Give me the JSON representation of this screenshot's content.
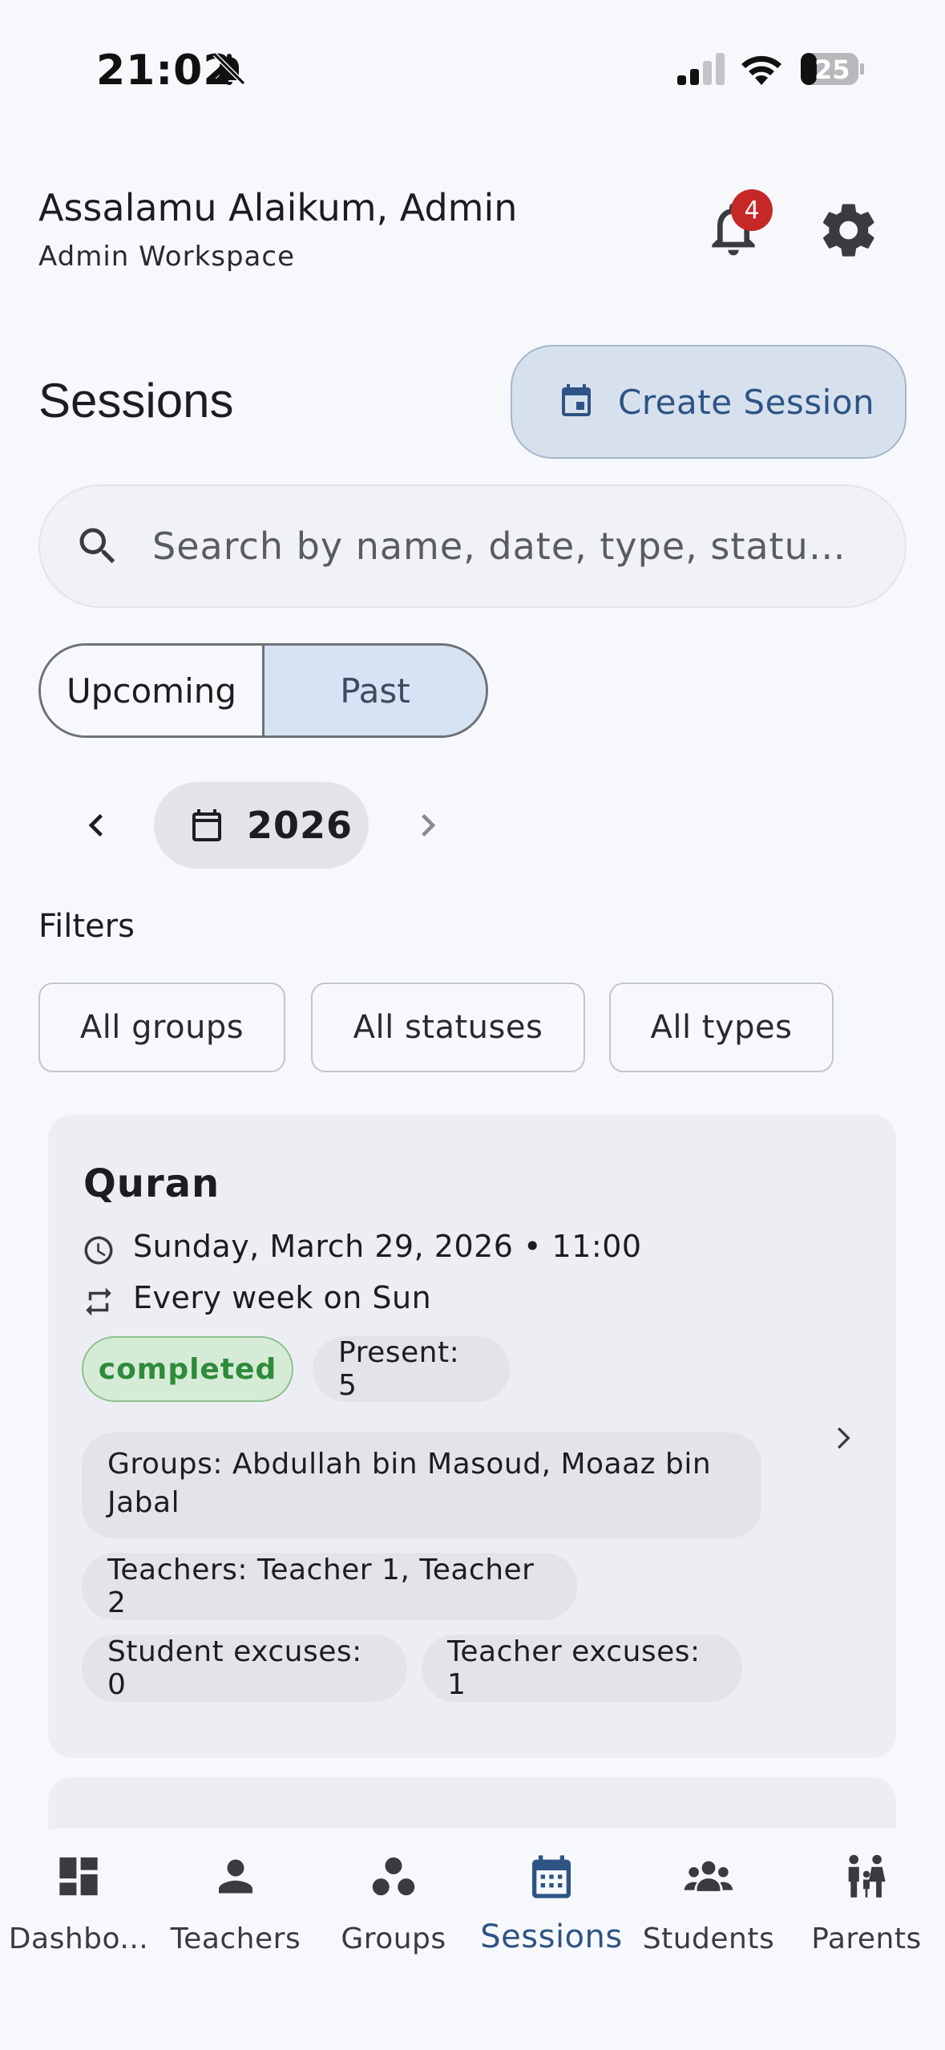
{
  "status_bar": {
    "time": "21:02",
    "battery": "25"
  },
  "header": {
    "greeting": "Assalamu Alaikum, Admin",
    "workspace": "Admin Workspace",
    "notification_count": "4"
  },
  "sessions": {
    "title": "Sessions",
    "create_label": "Create Session",
    "search_placeholder": "Search by name, date, type, statu…",
    "tabs": [
      "Upcoming",
      "Past"
    ],
    "selected_tab": "Past",
    "year": "2026",
    "filters_label": "Filters",
    "filters": [
      "All groups",
      "All statuses",
      "All types"
    ]
  },
  "session_card": {
    "title": "Quran",
    "datetime": "Sunday, March 29, 2026 • 11:00",
    "recurrence": "Every week on Sun",
    "status": "completed",
    "present": "Present: 5",
    "groups": "Groups: Abdullah bin Masoud, Moaaz bin Jabal",
    "teachers": "Teachers: Teacher 1, Teacher 2",
    "student_excuses": "Student excuses: 0",
    "teacher_excuses": "Teacher excuses: 1"
  },
  "nav": {
    "items": [
      {
        "label": "Dashbo...",
        "icon": "dashboard-icon"
      },
      {
        "label": "Teachers",
        "icon": "person-icon"
      },
      {
        "label": "Groups",
        "icon": "groups-icon"
      },
      {
        "label": "Sessions",
        "icon": "calendar-icon"
      },
      {
        "label": "Students",
        "icon": "students-icon"
      },
      {
        "label": "Parents",
        "icon": "family-icon"
      }
    ],
    "active": "Sessions"
  },
  "colors": {
    "accent": "#2d5485",
    "accent_bg": "#d7e1ee",
    "badge": "#c62828",
    "status_completed": "#2e8b3a"
  }
}
